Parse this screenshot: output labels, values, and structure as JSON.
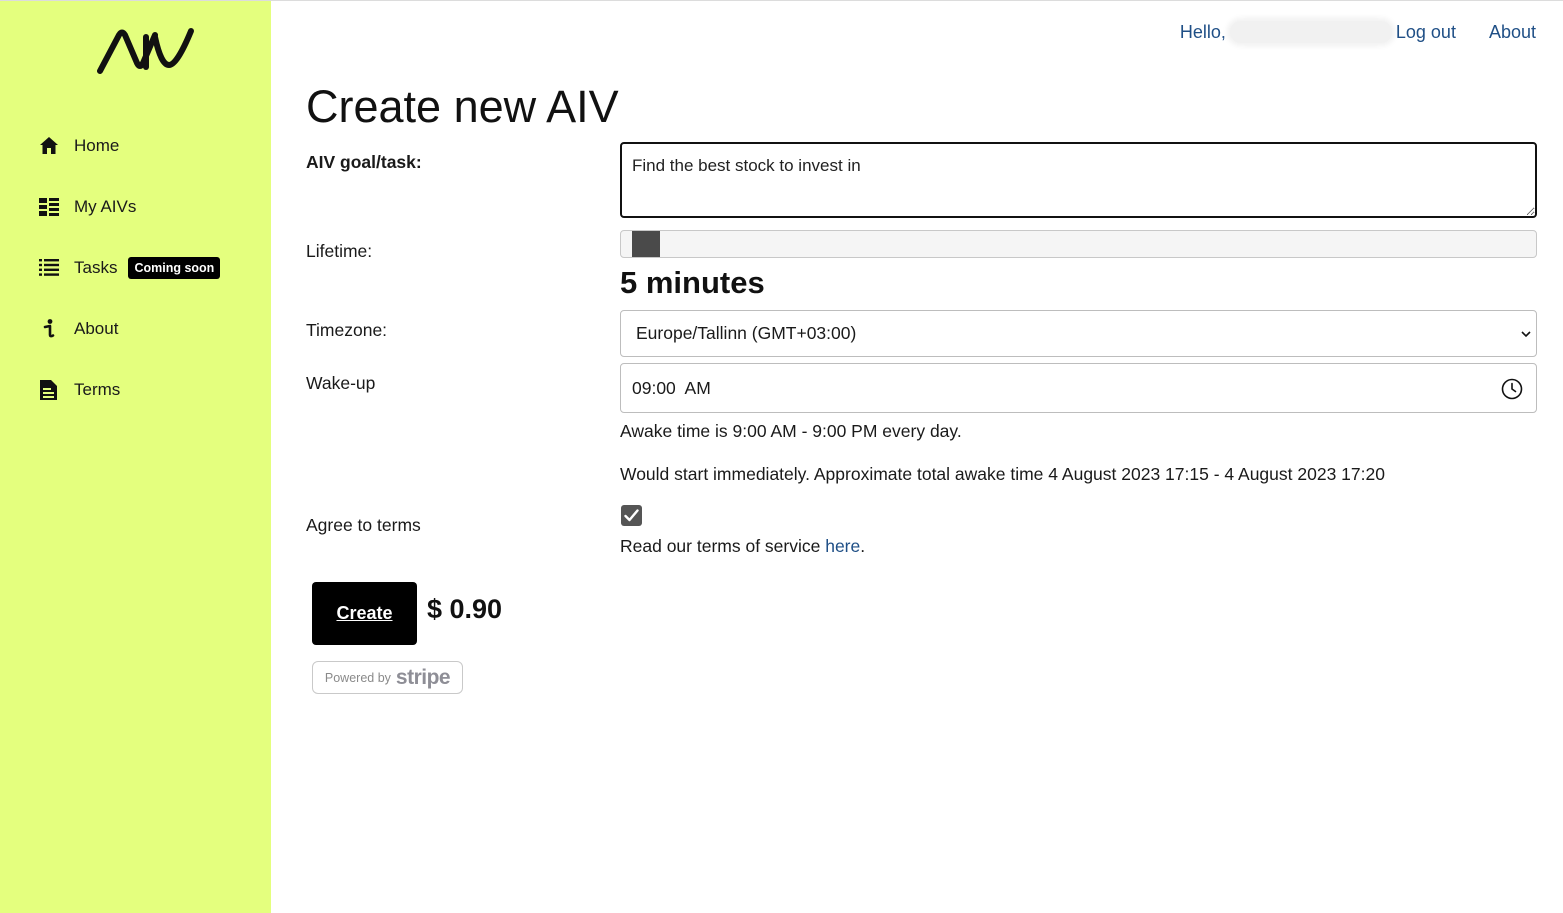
{
  "sidebar": {
    "logo": "AIV logo",
    "items": [
      {
        "icon": "home-icon",
        "label": "Home"
      },
      {
        "icon": "dashboard-icon",
        "label": "My AIVs"
      },
      {
        "icon": "list-icon",
        "label": "Tasks",
        "badge": "Coming soon"
      },
      {
        "icon": "info-icon",
        "label": "About"
      },
      {
        "icon": "document-icon",
        "label": "Terms"
      }
    ],
    "background": "#e4ff7e"
  },
  "header": {
    "hello": "Hello,",
    "logout": "Log out",
    "about": "About"
  },
  "page": {
    "title": "Create new AIV"
  },
  "form": {
    "goal_label": "AIV goal/task:",
    "goal_value": "Find the best stock to invest in",
    "lifetime_label": "Lifetime:",
    "lifetime_value": "5 minutes",
    "lifetime_slider_fraction": 0,
    "timezone_label": "Timezone:",
    "timezone_value": "Europe/Tallinn (GMT+03:00)",
    "wakeup_label": "Wake-up",
    "wakeup_value": "09:00  AM",
    "awake_text": "Awake time is 9:00 AM - 9:00 PM every day.",
    "start_text": "Would start immediately. Approximate total awake time 4 August 2023 17:15 - 4 August 2023 17:20",
    "terms_label": "Agree to terms",
    "terms_checked": true,
    "terms_text_prefix": "Read our terms of service ",
    "terms_link": "here",
    "terms_text_suffix": ".",
    "create_button": "Create",
    "price": "$ 0.90",
    "stripe_powered": "Powered by",
    "stripe_brand": "stripe"
  },
  "colors": {
    "accent": "#e4ff7e",
    "link": "#1f4f86",
    "button": "#000000"
  }
}
